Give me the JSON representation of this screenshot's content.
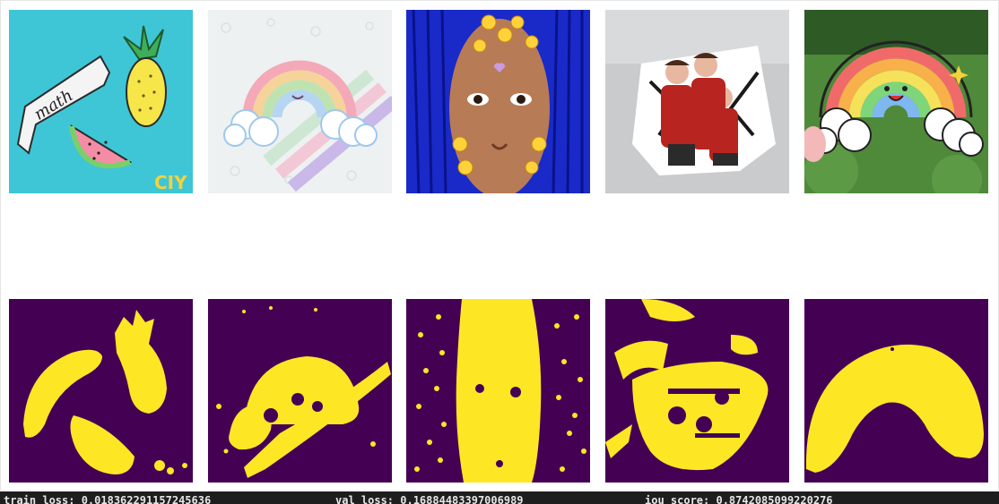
{
  "colors": {
    "mask_background": "#440154",
    "mask_foreground": "#fde725",
    "status_background": "#1e1e1e"
  },
  "images": [
    {
      "name": "math-pineapple-watermelon-stickers"
    },
    {
      "name": "pastel-rainbow-sticker-with-pencils"
    },
    {
      "name": "face-with-emoji-stickers"
    },
    {
      "name": "spiderman-trio-sticker-on-laptop"
    },
    {
      "name": "smiling-rainbow-sticker-on-grass"
    }
  ],
  "stickers": {
    "math_ribbon_text": "math",
    "brand_text": "CIY"
  },
  "metrics": {
    "train_loss_text": "train_loss: 0.018362291157245636",
    "val_loss_text": "val_loss: 0.16884483397006989",
    "iou_score_text": "iou_score: 0.8742085099220276"
  }
}
